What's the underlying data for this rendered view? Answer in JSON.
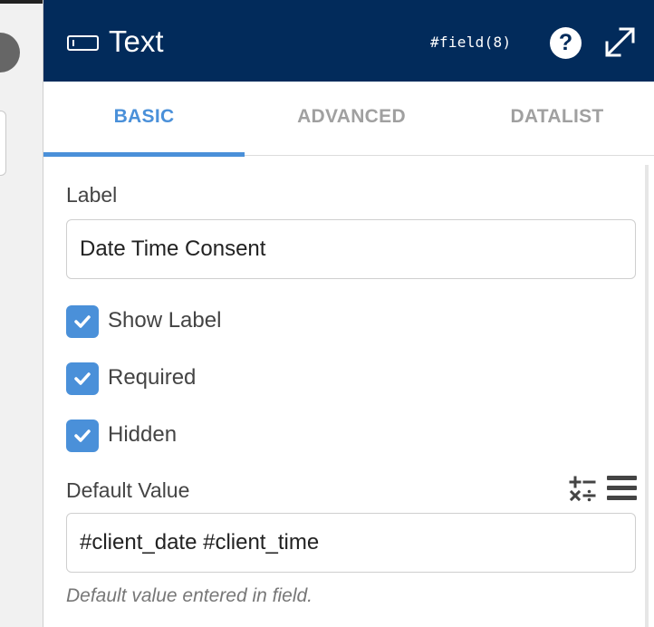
{
  "header": {
    "title": "Text",
    "field_id": "#field(8)",
    "type_icon": "text-input-icon",
    "help_icon": "question-circle-icon",
    "expand_icon": "expand-arrows-icon",
    "background": "#022b5b"
  },
  "tabs": [
    {
      "label": "BASIC",
      "active": true
    },
    {
      "label": "ADVANCED",
      "active": false
    },
    {
      "label": "DATALIST",
      "active": false
    }
  ],
  "form": {
    "label_heading": "Label",
    "label_value": "Date Time Consent",
    "checkboxes": [
      {
        "label": "Show Label",
        "checked": true
      },
      {
        "label": "Required",
        "checked": true
      },
      {
        "label": "Hidden",
        "checked": true
      }
    ],
    "default_value_heading": "Default Value",
    "default_value": "#client_date #client_time",
    "default_value_help": "Default value entered in field.",
    "calc_icon": "calculator-operators-icon",
    "menu_icon": "hamburger-menu-icon"
  },
  "colors": {
    "accent": "#4a90d9",
    "header_bg": "#022b5b"
  }
}
